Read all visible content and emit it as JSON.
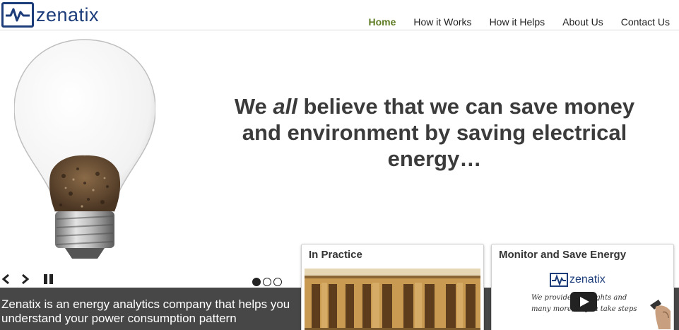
{
  "brand": {
    "name": "zenatix",
    "color": "#1c3d7a"
  },
  "nav": {
    "items": [
      {
        "label": "Home",
        "active": true
      },
      {
        "label": "How it Works",
        "active": false
      },
      {
        "label": "How it Helps",
        "active": false
      },
      {
        "label": "About Us",
        "active": false
      },
      {
        "label": "Contact Us",
        "active": false
      }
    ],
    "active_color": "#5e7b22"
  },
  "hero": {
    "headline_before": "We ",
    "headline_emphasis": "all",
    "headline_after": " believe that we can save money and environment by saving electrical energy…",
    "slide_count": 3,
    "active_slide": 1
  },
  "band": {
    "text": "Zenatix is an energy analytics company that helps you understand your power consumption pattern"
  },
  "cards": [
    {
      "title": "In Practice",
      "image": "building-photo"
    },
    {
      "title": "Monitor and Save Energy",
      "image": "video-thumbnail",
      "video_brand": "zenatix",
      "video_line1": "We provide … insights and",
      "video_line2": "many more, … you take steps"
    }
  ],
  "icons": {
    "prev": "chevron-left-icon",
    "next": "chevron-right-icon",
    "pause": "pause-icon",
    "play": "play-icon"
  }
}
